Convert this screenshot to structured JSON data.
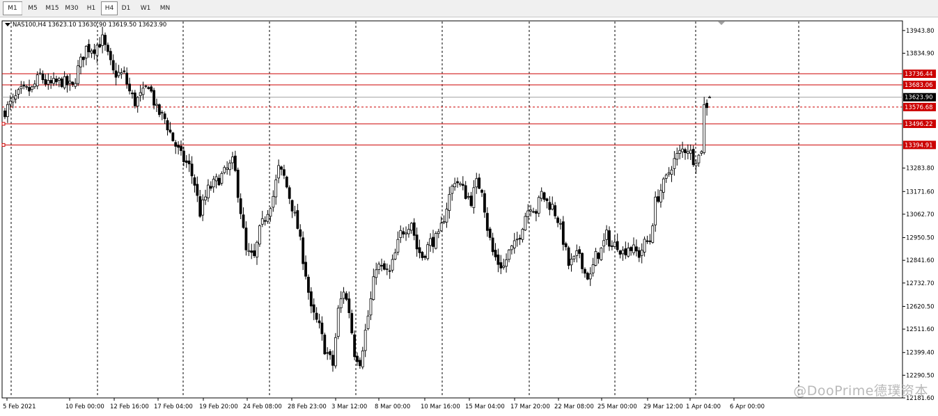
{
  "toolbar": {
    "timeframes": [
      "M1",
      "M5",
      "M15",
      "M30",
      "H1",
      "H4",
      "D1",
      "W1",
      "MN"
    ],
    "active": "H4"
  },
  "symbol_info": {
    "text": "NAS100,H4  13623.10 13630.90 13619.50 13623.90"
  },
  "watermark": "@DooPrime德璞资本",
  "colors": {
    "bull_candle": "#ffffff",
    "bear_candle": "#000000",
    "level_line": "#cc0000",
    "current_price_tag": "#000000",
    "grid": "#000000",
    "background": "#ffffff"
  },
  "chart_data": {
    "type": "candlestick",
    "symbol": "NAS100",
    "timeframe": "H4",
    "ohlc_readout": {
      "open": 13623.1,
      "high": 13630.9,
      "low": 13619.5,
      "close": 13623.9
    },
    "current_price": 13623.9,
    "ylim": [
      12181.6,
      13990
    ],
    "y_ticks": [
      13943.8,
      13834.9,
      13726.8,
      13623.9,
      13576.68,
      13496.22,
      13394.91,
      13283.8,
      13171.6,
      13062.7,
      12950.5,
      12841.6,
      12732.7,
      12620.5,
      12511.6,
      12399.4,
      12290.5,
      12181.6
    ],
    "y_tick_labels": [
      "13943.80",
      "13834.90",
      "",
      "",
      "",
      "",
      "",
      "13283.80",
      "13171.60",
      "13062.70",
      "12950.50",
      "12841.60",
      "12732.70",
      "12620.50",
      "12511.60",
      "12399.40",
      "12290.50",
      "12181.60"
    ],
    "x_tick_labels": [
      "5 Feb 2021",
      "10 Feb 00:00",
      "12 Feb 16:00",
      "17 Feb 04:00",
      "19 Feb 20:00",
      "24 Feb 08:00",
      "28 Feb 23:00",
      "3 Mar 12:00",
      "8 Mar 00:00",
      "10 Mar 16:00",
      "15 Mar 04:00",
      "17 Mar 20:00",
      "22 Mar 08:00",
      "25 Mar 00:00",
      "29 Mar 12:00",
      "1 Apr 04:00",
      "6 Apr 00:00"
    ],
    "grid": "vertical-dotted",
    "horizontal_levels": [
      {
        "price": 13736.44,
        "label": "13736.44",
        "style": "solid"
      },
      {
        "price": 13683.06,
        "label": "13683.06",
        "style": "solid"
      },
      {
        "price": 13576.68,
        "label": "13576.68",
        "style": "dashed"
      },
      {
        "price": 13496.22,
        "label": "13496.22",
        "style": "solid"
      },
      {
        "price": 13394.91,
        "label": "13394.91",
        "style": "solid"
      }
    ],
    "anchors": [
      [
        0,
        13560
      ],
      [
        6,
        13650
      ],
      [
        10,
        13660
      ],
      [
        13,
        13730
      ],
      [
        16,
        13680
      ],
      [
        21,
        13700
      ],
      [
        25,
        13670
      ],
      [
        27,
        13760
      ],
      [
        30,
        13860
      ],
      [
        33,
        13860
      ],
      [
        36,
        13900
      ],
      [
        38,
        13820
      ],
      [
        40,
        13740
      ],
      [
        44,
        13730
      ],
      [
        46,
        13650
      ],
      [
        48,
        13600
      ],
      [
        51,
        13640
      ],
      [
        53,
        13690
      ],
      [
        56,
        13560
      ],
      [
        59,
        13520
      ],
      [
        62,
        13420
      ],
      [
        65,
        13340
      ],
      [
        68,
        13290
      ],
      [
        70,
        13210
      ],
      [
        72,
        13070
      ],
      [
        75,
        13180
      ],
      [
        78,
        13220
      ],
      [
        81,
        13260
      ],
      [
        84,
        13310
      ],
      [
        85,
        13260
      ],
      [
        87,
        13080
      ],
      [
        89,
        12880
      ],
      [
        92,
        12850
      ],
      [
        94,
        12980
      ],
      [
        96,
        13050
      ],
      [
        99,
        13150
      ],
      [
        101,
        13280
      ],
      [
        103,
        13240
      ],
      [
        106,
        13100
      ],
      [
        108,
        13000
      ],
      [
        111,
        12780
      ],
      [
        113,
        12600
      ],
      [
        116,
        12520
      ],
      [
        118,
        12420
      ],
      [
        121,
        12340
      ],
      [
        123,
        12600
      ],
      [
        125,
        12700
      ],
      [
        127,
        12600
      ],
      [
        129,
        12400
      ],
      [
        131,
        12360
      ],
      [
        133,
        12500
      ],
      [
        135,
        12650
      ],
      [
        137,
        12820
      ],
      [
        139,
        12800
      ],
      [
        142,
        12780
      ],
      [
        144,
        12870
      ],
      [
        146,
        12970
      ],
      [
        148,
        13000
      ],
      [
        150,
        13030
      ],
      [
        152,
        12900
      ],
      [
        154,
        12860
      ],
      [
        157,
        12930
      ],
      [
        160,
        12950
      ],
      [
        162,
        13050
      ],
      [
        164,
        13150
      ],
      [
        166,
        13230
      ],
      [
        168,
        13200
      ],
      [
        170,
        13160
      ],
      [
        172,
        13130
      ],
      [
        174,
        13210
      ],
      [
        176,
        13190
      ],
      [
        178,
        13000
      ],
      [
        180,
        12880
      ],
      [
        182,
        12830
      ],
      [
        184,
        12810
      ],
      [
        186,
        12880
      ],
      [
        188,
        12910
      ],
      [
        190,
        12970
      ],
      [
        192,
        13060
      ],
      [
        194,
        13110
      ],
      [
        196,
        13080
      ],
      [
        198,
        13160
      ],
      [
        200,
        13120
      ],
      [
        202,
        13100
      ],
      [
        204,
        13040
      ],
      [
        206,
        12940
      ],
      [
        208,
        12820
      ],
      [
        210,
        12840
      ],
      [
        212,
        12880
      ],
      [
        214,
        12780
      ],
      [
        216,
        12760
      ],
      [
        218,
        12860
      ],
      [
        220,
        12890
      ],
      [
        222,
        12960
      ],
      [
        224,
        12910
      ],
      [
        226,
        12920
      ],
      [
        228,
        12880
      ],
      [
        230,
        12910
      ],
      [
        232,
        12890
      ],
      [
        234,
        12870
      ],
      [
        236,
        12920
      ],
      [
        238,
        12940
      ],
      [
        240,
        13120
      ],
      [
        242,
        13180
      ],
      [
        244,
        13230
      ],
      [
        246,
        13300
      ],
      [
        248,
        13340
      ],
      [
        250,
        13370
      ],
      [
        252,
        13380
      ],
      [
        254,
        13330
      ],
      [
        256,
        13340
      ],
      [
        257,
        13380
      ],
      [
        258,
        13580
      ],
      [
        259,
        13590
      ],
      [
        260,
        13623.9
      ]
    ]
  }
}
